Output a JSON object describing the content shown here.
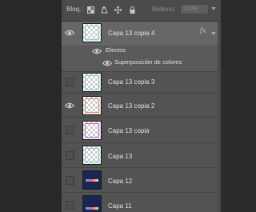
{
  "toolbar": {
    "lock_label": "Bloq.:",
    "lock_icons": [
      "lock-transparent-pixels-icon",
      "lock-image-pixels-icon",
      "lock-position-icon",
      "lock-all-icon"
    ],
    "fill_label": "Relleno:",
    "fill_value": "100%"
  },
  "layers": [
    {
      "name": "Capa 13 copia 4",
      "visible": true,
      "selected": true,
      "has_fx": true,
      "fx_label": "fx",
      "thumb_frame": "#7fd3e0"
    },
    {
      "effects_label": "Efectos",
      "effect_item": "Superposición de colores"
    },
    {
      "name": "Capa 13 copia 3",
      "visible": false,
      "thumb_frame": "#7fd3e0"
    },
    {
      "name": "Capa 13 copia 2",
      "visible": true,
      "thumb_frame": "#e38a7e"
    },
    {
      "name": "Capa 13 copia",
      "visible": false,
      "thumb_frame": "#c36bd7"
    },
    {
      "name": "Capa 13",
      "visible": false,
      "thumb_frame": "#7fd3e0"
    },
    {
      "name": "Capa 12",
      "visible": false,
      "thumb_style": "dark"
    },
    {
      "name": "Capa 11",
      "visible": false,
      "thumb_style": "dark"
    }
  ]
}
